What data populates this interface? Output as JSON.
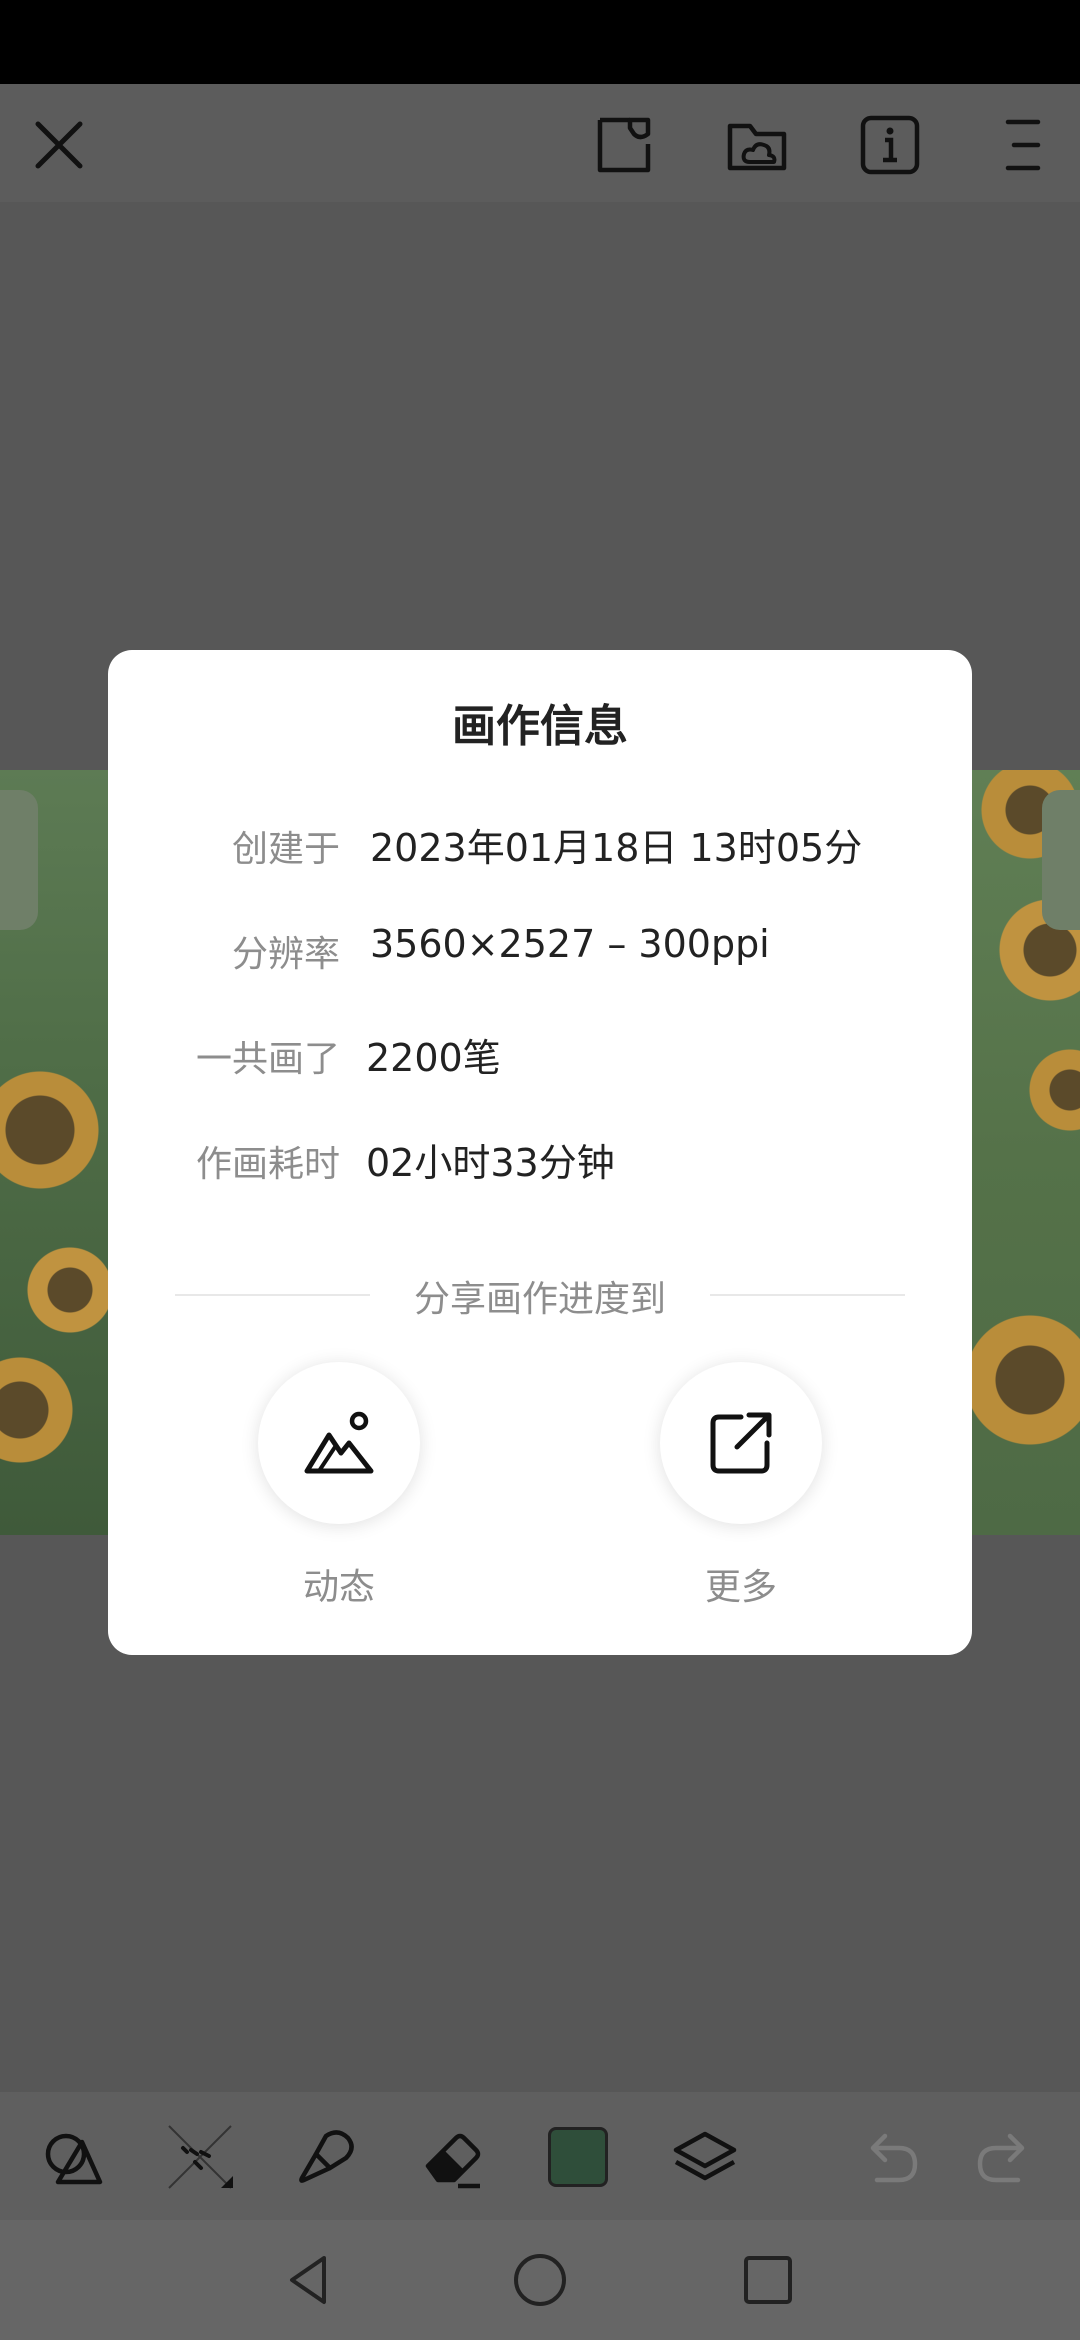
{
  "dialog": {
    "title": "画作信息",
    "rows": [
      {
        "label": "创建于",
        "value": "2023年01月18日 13时05分"
      },
      {
        "label": "分辨率",
        "value": "3560×2527 – 300ppi"
      },
      {
        "label": "一共画了",
        "value": "2200笔"
      },
      {
        "label": "作画耗时",
        "value": "02小时33分钟"
      }
    ],
    "share_title": "分享画作进度到",
    "share_options": [
      {
        "label": "动态",
        "icon": "mountain-image-icon"
      },
      {
        "label": "更多",
        "icon": "external-share-icon"
      }
    ]
  },
  "topbar_icons": [
    "close-icon",
    "notebook-icon",
    "cloud-folder-icon",
    "info-icon",
    "menu-icon"
  ],
  "toolbar_icons": [
    "shapes-icon",
    "transform-icon",
    "brush-icon",
    "eraser-icon",
    "color-swatch",
    "layers-icon",
    "undo-icon",
    "redo-icon"
  ],
  "colors": {
    "current_color": "#2f4e3a",
    "overlay": "#575757"
  }
}
